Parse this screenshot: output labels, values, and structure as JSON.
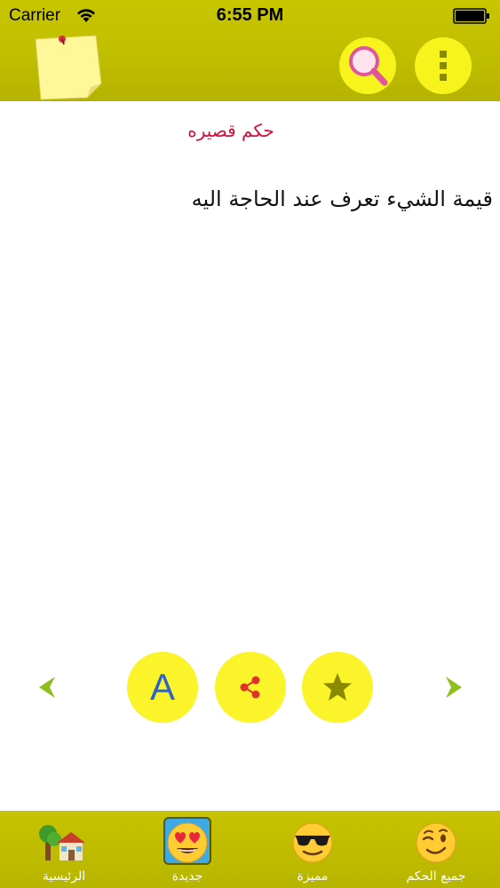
{
  "status_bar": {
    "carrier": "Carrier",
    "time": "6:55 PM"
  },
  "header": {
    "logo_icon": "sticky-note-icon",
    "search_icon": "magnifier-icon",
    "menu_icon": "vertical-dots-icon"
  },
  "content": {
    "category_title": "حكم قصيره",
    "saying": "قيمة الشيء تعرف عند الحاجة اليه"
  },
  "actions": {
    "font_letter": "A",
    "share_icon": "share-icon",
    "favorite_icon": "star-icon",
    "prev_icon": "left-arrow-icon",
    "next_icon": "right-arrow-icon"
  },
  "tab_bar": {
    "items": [
      {
        "label": "الرئيسية",
        "icon": "house-tree-icon"
      },
      {
        "label": "جديدة",
        "icon": "heart-eyes-emoji-icon"
      },
      {
        "label": "مميزة",
        "icon": "sunglasses-emoji-icon"
      },
      {
        "label": "جميع الحكم",
        "icon": "wink-emoji-icon"
      }
    ]
  },
  "colors": {
    "header_bg": "#c8c600",
    "accent_yellow": "#fbf42a",
    "title_red": "#d0103a",
    "font_blue": "#2b63c9",
    "arrow_green": "#8fbf1f"
  }
}
